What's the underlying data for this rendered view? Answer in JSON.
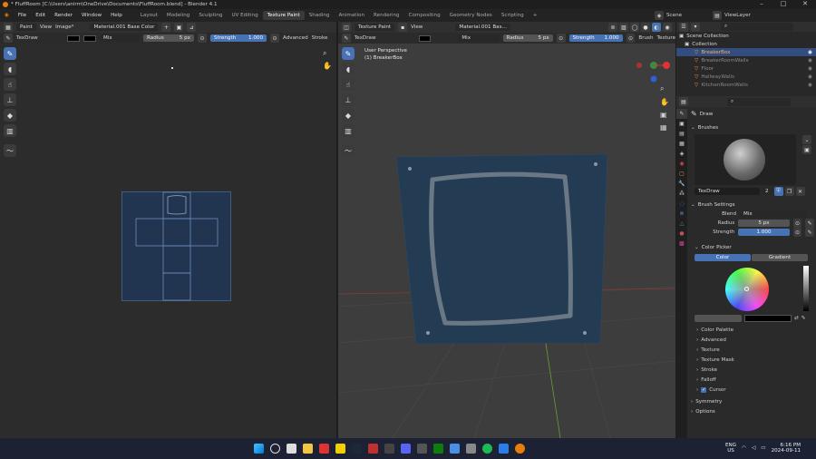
{
  "title": "* FluffRoom [C:\\Users\\anirm\\OneDrive\\Documents\\FluffRoom.blend] - Blender 4.1",
  "menu": [
    "File",
    "Edit",
    "Render",
    "Window",
    "Help"
  ],
  "workspaces": [
    "Layout",
    "Modeling",
    "Sculpting",
    "UV Editing",
    "Texture Paint",
    "Shading",
    "Animation",
    "Rendering",
    "Compositing",
    "Geometry Nodes",
    "Scripting",
    "+"
  ],
  "scene": "Scene",
  "view_layer": "ViewLayer",
  "left_header": {
    "mode": "Paint",
    "view": "View",
    "image": "Image*",
    "material": "Material.001 Base Color",
    "brush": "TexDraw",
    "blend": "Mix",
    "radius_label": "Radius",
    "radius_value": "5 px",
    "strength_label": "Strength",
    "strength_value": "1.000",
    "advanced": "Advanced",
    "stroke": "Stroke"
  },
  "right_header": {
    "mode": "Texture Paint",
    "view": "View",
    "material": "Material.001 Bas...",
    "brush": "TexDraw",
    "blend": "Mix",
    "radius_label": "Radius",
    "radius_value": "5 px",
    "strength_label": "Strength",
    "strength_value": "1.000",
    "brush_menu": "Brush",
    "texture": "Texture"
  },
  "viewport": {
    "perspective": "User Perspective",
    "object": "(1) BreakerBox"
  },
  "outliner": {
    "search_placeholder": "",
    "rows": [
      {
        "label": "Scene Collection",
        "type": "root"
      },
      {
        "label": "Collection",
        "type": "collection"
      },
      {
        "label": "BreakerBox",
        "type": "object",
        "selected": true
      },
      {
        "label": "BreakerRoomWalls",
        "type": "object"
      },
      {
        "label": "Floor",
        "type": "object"
      },
      {
        "label": "HallwayWalls",
        "type": "object"
      },
      {
        "label": "KitchenRoomWalls",
        "type": "object"
      }
    ]
  },
  "properties": {
    "tool_name": "Draw",
    "brushes_header": "Brushes",
    "brush_name": "TexDraw",
    "brush_users": "2",
    "brush_settings": "Brush Settings",
    "blend_label": "Blend",
    "blend_value": "Mix",
    "radius_label": "Radius",
    "radius_value": "5 px",
    "strength_label": "Strength",
    "strength_value": "1.000",
    "color_picker": "Color Picker",
    "color_tab": "Color",
    "gradient_tab": "Gradient",
    "subpanels": [
      "Color Palette",
      "Advanced",
      "Texture",
      "Texture Mask",
      "Stroke",
      "Falloff",
      "Cursor"
    ],
    "symmetry": "Symmetry",
    "options": "Options"
  },
  "taskbar": {
    "lang": "ENG",
    "region": "US",
    "time": "6:16 PM",
    "date": "2024-09-11"
  },
  "colors": {
    "accent": "#4772b3",
    "uv_fill": "#213550",
    "plane_fill": "#243b54"
  }
}
